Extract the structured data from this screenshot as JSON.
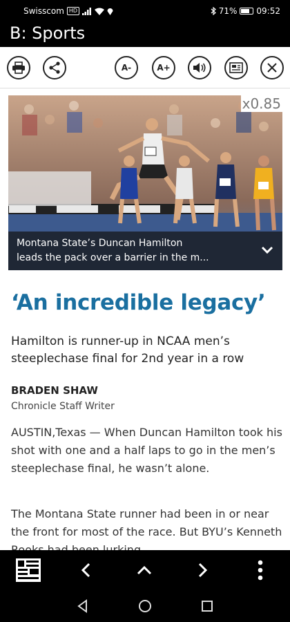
{
  "status_bar": {
    "carrier": "Swisscom",
    "network_badge": "HD",
    "battery_text": "71%",
    "battery_level": 0.71,
    "time": "09:52"
  },
  "header": {
    "title": "B: Sports"
  },
  "toolbar": {
    "buttons": [
      {
        "name": "print-icon"
      },
      {
        "name": "share-icon"
      },
      {
        "name": "font-decrease",
        "label": "A-"
      },
      {
        "name": "font-increase",
        "label": "A+"
      },
      {
        "name": "speaker-icon"
      },
      {
        "name": "article-view-icon"
      },
      {
        "name": "close-icon"
      }
    ]
  },
  "photo": {
    "zoom": "x0.85",
    "caption_line1": "Montana State’s Duncan Hamilton",
    "caption_line2": "leads the pack over a barrier in the m..."
  },
  "article": {
    "headline": "‘An incredible legacy’",
    "subhead": "Hamilton is runner-up in NCAA men’s steeplechase final for 2nd year in a row",
    "author": "BRADEN SHAW",
    "author_title": "Chronicle Staff Writer",
    "paragraph1": "AUSTIN,Texas — When Duncan Hamilton took his shot with one and a half laps to go in the men’s steeplechase final, he wasn’t alone.",
    "paragraph2": "The Montana State runner had been in or near the front for most of the race. But BYU’s Kenneth Rooks had been lurking"
  },
  "colors": {
    "headline": "#1a6fa0",
    "bars": "#000000"
  }
}
